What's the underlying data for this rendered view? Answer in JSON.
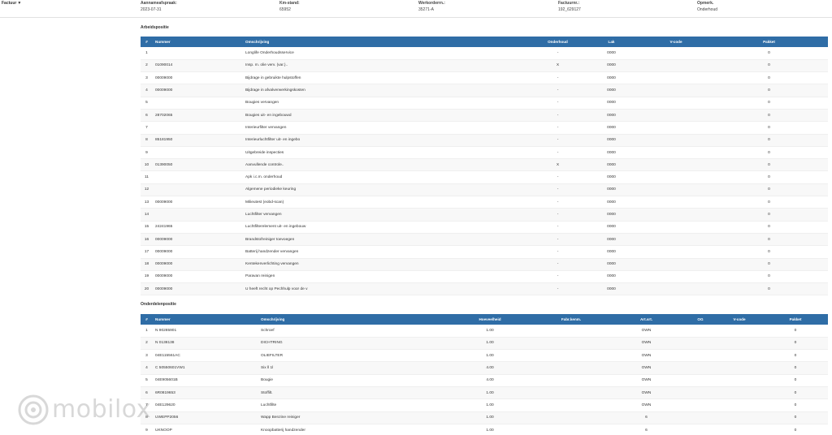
{
  "header": {
    "factuur_label": "Factuur",
    "fields": [
      {
        "label": "Aannameafspraak:",
        "value": "2023-07-31"
      },
      {
        "label": "Km-stand:",
        "value": "65952"
      },
      {
        "label": "Werkorderrn.:",
        "value": "35271-A"
      },
      {
        "label": "Factuurnr.:",
        "value": "192_629127"
      },
      {
        "label": "Opmerk.",
        "value": "Onderhoud"
      }
    ]
  },
  "arbeid": {
    "title": "Arbeidspositie",
    "columns": [
      "#",
      "Nummer",
      "Omschrijving",
      "Onderhoud",
      "Lak",
      "V-code",
      "Pakket"
    ],
    "rows": [
      [
        "1",
        "",
        "Longlife Onderhoudsservice",
        "-",
        "0000",
        "",
        "0"
      ],
      [
        "2",
        "01090014",
        "Insp. m. olie verv. (var.)..",
        "X",
        "0000",
        "",
        "0"
      ],
      [
        "3",
        "00009000",
        "Bijdrage in gebruikte hulpstoffen",
        "-",
        "0000",
        "",
        "0"
      ],
      [
        "4",
        "00009000",
        "Bijdrage in afvalverwerkingskosten",
        "-",
        "0000",
        "",
        "0"
      ],
      [
        "5",
        "",
        "Bougies vervangen",
        "-",
        "0000",
        "",
        "0"
      ],
      [
        "6",
        "28702065",
        "Bougies uit- en ingebouwd",
        "-",
        "0000",
        "",
        "0"
      ],
      [
        "7",
        "",
        "Interieurfilter vervangen",
        "-",
        "0000",
        "",
        "0"
      ],
      [
        "8",
        "85181950",
        "Interieurluchtfilter uit- en ingebo",
        "-",
        "0000",
        "",
        "0"
      ],
      [
        "9",
        "",
        "Uitgebreide inspecties",
        "-",
        "0000",
        "",
        "0"
      ],
      [
        "10",
        "01390050",
        "Aanvullende controle..",
        "X",
        "0000",
        "",
        "0"
      ],
      [
        "11",
        "",
        "Apk i.c.m. onderhoud",
        "-",
        "0000",
        "",
        "0"
      ],
      [
        "12",
        "",
        "Algemene periodieke keuring",
        "-",
        "0000",
        "",
        "0"
      ],
      [
        "13",
        "00009000",
        "Milieutest (eobd-scan)",
        "-",
        "0000",
        "",
        "0"
      ],
      [
        "14",
        "",
        "Luchtfilter vervangen",
        "-",
        "0000",
        "",
        "0"
      ],
      [
        "15",
        "24241965",
        "Luchtfilterelement uit- en ingebouw",
        "-",
        "0000",
        "",
        "0"
      ],
      [
        "16",
        "00009000",
        "Brandstofreiniger toevoegen",
        "-",
        "0000",
        "",
        "0"
      ],
      [
        "17",
        "00009000",
        "Batterij handzender vervangen",
        "-",
        "0000",
        "",
        "0"
      ],
      [
        "18",
        "00009000",
        "Kentekenverlichting vervangen",
        "-",
        "0000",
        "",
        "0"
      ],
      [
        "19",
        "00009000",
        "Paravan reinigen",
        "-",
        "0000",
        "",
        "0"
      ],
      [
        "20",
        "00009000",
        "U heeft recht op Pechhulp voor de v",
        "-",
        "0000",
        "",
        "0"
      ]
    ]
  },
  "onderdelen": {
    "title": "Onderdelenpositie",
    "columns": [
      "#",
      "Nummer",
      "Omschrijving",
      "Hoeveelheid",
      "Fabr.kenm.",
      "Art.srt.",
      "OG",
      "V-code",
      "Pakket"
    ],
    "rows": [
      [
        "1",
        "N 90285901",
        "Schroef",
        "1.00",
        "",
        "OWN",
        "",
        "",
        "0"
      ],
      [
        "2",
        "N 0138138",
        "DICHTRING",
        "1.00",
        "",
        "OWN",
        "",
        "",
        "0"
      ],
      [
        "3",
        "04E115561AC",
        "OLIEFILTER",
        "1.00",
        "",
        "OWN",
        "",
        "",
        "0"
      ],
      [
        "4",
        "C 50550601VW1",
        "Six ll 1l",
        "4.00",
        "",
        "OWN",
        "",
        "",
        "0"
      ],
      [
        "5",
        "04E905601B",
        "Bougie",
        "4.00",
        "",
        "OWN",
        "",
        "",
        "0"
      ],
      [
        "6",
        "6R0819653",
        "Stoffilt.",
        "1.00",
        "",
        "OWN",
        "",
        "",
        "0"
      ],
      [
        "7",
        "04E129620",
        "Luchtfilte",
        "1.00",
        "",
        "OWN",
        "",
        "",
        "0"
      ],
      [
        "8",
        "UWEPP2056",
        "Wapp Benzine reiniger",
        "1.00",
        "",
        "6",
        "",
        "",
        "0"
      ],
      [
        "9",
        "UKNOOP",
        "Knoopbatterij handzender",
        "1.00",
        "",
        "6",
        "",
        "",
        "0"
      ]
    ]
  },
  "watermark": {
    "text": "mobilox"
  },
  "colors": {
    "table_header": "#2f6da6"
  }
}
